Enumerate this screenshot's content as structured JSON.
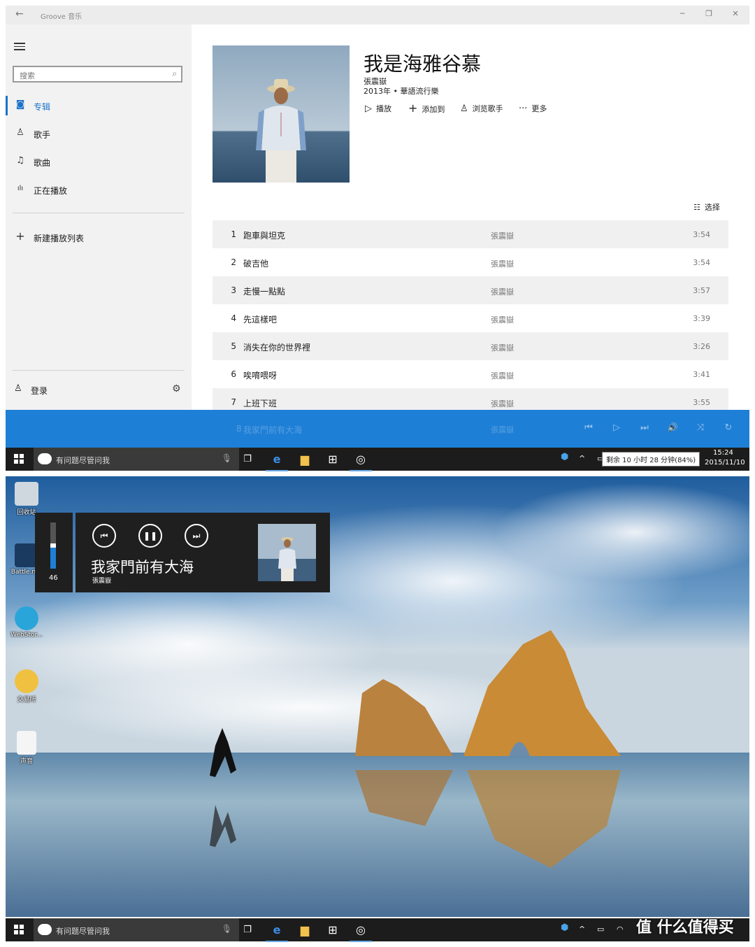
{
  "window": {
    "app_title": "Groove 音乐",
    "back_glyph": "←",
    "ctl": {
      "minimize": "─",
      "restore": "❐",
      "close": "✕"
    }
  },
  "sidebar": {
    "search_placeholder": "搜索",
    "nav": [
      {
        "icon": "album-icon",
        "glyph": "◙",
        "label": "专辑",
        "active": true
      },
      {
        "icon": "artist-icon",
        "glyph": "♙",
        "label": "歌手",
        "active": false
      },
      {
        "icon": "song-icon",
        "glyph": "♫",
        "label": "歌曲",
        "active": false
      },
      {
        "icon": "now-playing-icon",
        "glyph": "ılı",
        "label": "正在播放",
        "active": false
      }
    ],
    "new_playlist": {
      "glyph": "+",
      "label": "新建播放列表"
    },
    "login": {
      "glyph": "♙",
      "label": "登录"
    },
    "settings_glyph": "⚙"
  },
  "album": {
    "title": "我是海雅谷慕",
    "artist": "張震嶽",
    "meta": "2013年 • 華語流行樂",
    "actions": [
      {
        "name": "play-button",
        "icon": "play-icon",
        "glyph": "▷",
        "label": "播放"
      },
      {
        "name": "add-to-button",
        "icon": "plus-icon",
        "glyph": "+",
        "label": "添加到"
      },
      {
        "name": "browse-artist-button",
        "icon": "person-icon",
        "glyph": "♙",
        "label": "浏览歌手"
      },
      {
        "name": "more-button",
        "icon": "more-icon",
        "glyph": "···",
        "label": "更多"
      }
    ],
    "select_label": "选择",
    "select_glyph": "☷"
  },
  "tracks": [
    {
      "num": "1",
      "title": "跑車與坦克",
      "artist": "張震嶽",
      "duration": "3:54"
    },
    {
      "num": "2",
      "title": "破吉他",
      "artist": "張震嶽",
      "duration": "3:54"
    },
    {
      "num": "3",
      "title": "走慢一點點",
      "artist": "張震嶽",
      "duration": "3:57"
    },
    {
      "num": "4",
      "title": "先這樣吧",
      "artist": "張震嶽",
      "duration": "3:39"
    },
    {
      "num": "5",
      "title": "消失在你的世界裡",
      "artist": "張震嶽",
      "duration": "3:26"
    },
    {
      "num": "6",
      "title": "唉唷喂呀",
      "artist": "張震嶽",
      "duration": "3:41"
    },
    {
      "num": "7",
      "title": "上班下班",
      "artist": "張震嶽",
      "duration": "3:55"
    }
  ],
  "playerbar": {
    "ghost_num": "8",
    "ghost_title": "我家門前有大海",
    "ghost_artist": "張震嶽",
    "controls": [
      {
        "name": "prev-button",
        "icon": "prev-icon",
        "glyph": "⏮"
      },
      {
        "name": "play-button",
        "icon": "play-icon",
        "glyph": "▷"
      },
      {
        "name": "next-button",
        "icon": "next-icon",
        "glyph": "⏭"
      },
      {
        "name": "volume-button",
        "icon": "volume-icon",
        "glyph": "🔊"
      },
      {
        "name": "shuffle-button",
        "icon": "shuffle-icon",
        "glyph": "⤨"
      },
      {
        "name": "repeat-button",
        "icon": "repeat-icon",
        "glyph": "↻"
      }
    ]
  },
  "taskbar_top": {
    "search_text": "有问题尽管问我",
    "battery_tooltip": "剩余 10 小时 28 分钟(84%)",
    "time": "15:24",
    "date": "2015/11/10"
  },
  "taskbar_bottom": {
    "search_text": "有问题尽管问我"
  },
  "desktop": {
    "icons": [
      {
        "name": "recycle-bin-icon",
        "label": "回收站"
      },
      {
        "name": "battlenet-icon",
        "label": "Battle.net"
      },
      {
        "name": "webstorm-icon",
        "label": "WebStor..."
      },
      {
        "name": "kt-icon",
        "label": "交易所"
      },
      {
        "name": "doc-icon",
        "label": "声音"
      }
    ],
    "volume_level": "46",
    "volume_fraction": 0.46,
    "media": {
      "title": "我家門前有大海",
      "artist": "張震嶽"
    }
  },
  "watermark": "值 什么值得买",
  "colors": {
    "accent": "#1e7fd6",
    "taskbar": "#1c1c1c",
    "flyout": "#1f1f1f"
  }
}
